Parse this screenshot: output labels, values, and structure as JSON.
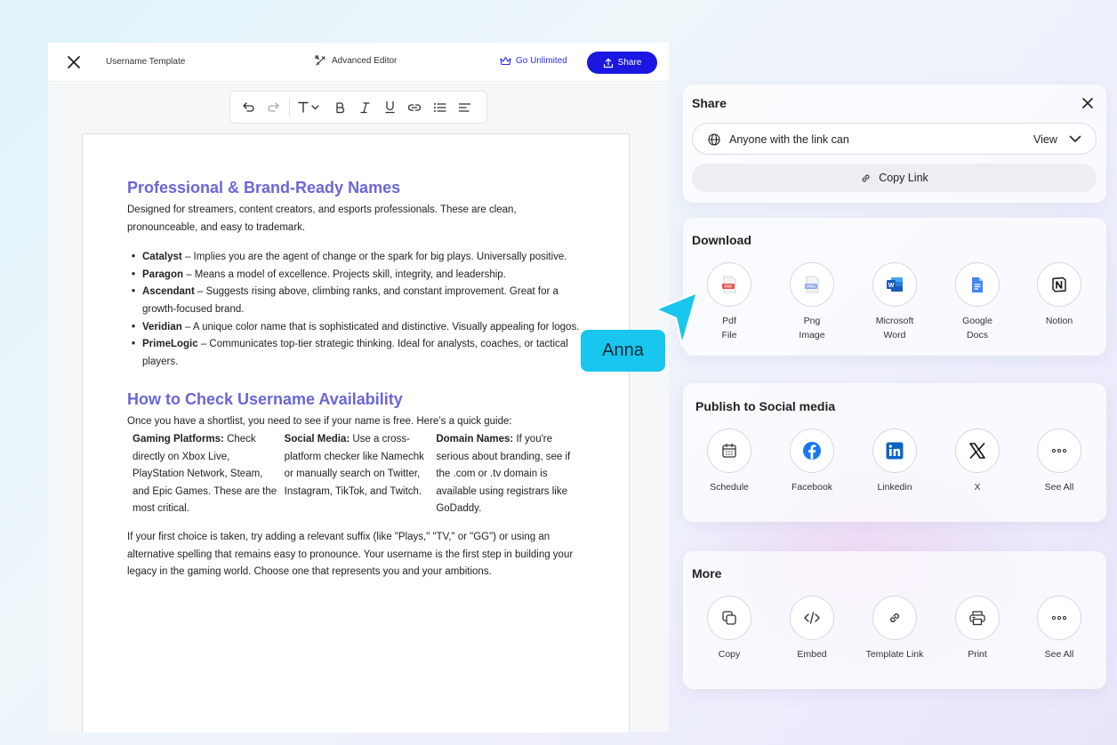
{
  "editor": {
    "doc_title": "Username Template",
    "advanced_editor": "Advanced Editor",
    "go_unlimited": "Go Unlimited",
    "share": "Share",
    "toolbar_icons": [
      "undo-icon",
      "redo-icon",
      "text-style-icon",
      "bold-icon",
      "italic-icon",
      "underline-icon",
      "link-icon",
      "bullet-list-icon",
      "align-left-icon"
    ]
  },
  "document": {
    "section1": {
      "heading": "Professional & Brand-Ready Names",
      "intro": "Designed for streamers, content creators, and esports professionals. These are clean, pronounceable, and easy to trademark.",
      "items": [
        {
          "name": "Catalyst",
          "desc": " – Implies you are the agent of change or the spark for big plays. Universally positive."
        },
        {
          "name": "Paragon",
          "desc": " – Means a model of excellence. Projects skill, integrity, and leadership."
        },
        {
          "name": "Ascendant",
          "desc": " – Suggests rising above, climbing ranks, and constant improvement. Great for a growth-focused brand."
        },
        {
          "name": "Veridian",
          "desc": " – A unique color name that is sophisticated and distinctive. Visually appealing for logos."
        },
        {
          "name": "PrimeLogic",
          "desc": " – Communicates top-tier strategic thinking. Ideal for analysts, coaches, or tactical players."
        }
      ]
    },
    "section2": {
      "heading": "How to Check Username Availability",
      "intro": "Once you have a shortlist, you need to see if your name is free. Here’s a quick guide:",
      "columns": [
        {
          "title": "Gaming Platforms:",
          "text": " Check directly on Xbox Live, PlayStation Network, Steam, and Epic Games. These are the most critical."
        },
        {
          "title": "Social Media:",
          "text": " Use a cross-platform checker like Namechk or manually search on Twitter, Instagram, TikTok, and Twitch."
        },
        {
          "title": "Domain Names:",
          "text": " If you're serious about branding, see if the .com or .tv domain is available using registrars like GoDaddy."
        }
      ],
      "closing": "If your first choice is taken, try adding a relevant suffix (like \"Plays,\" \"TV,\" or \"GG\") or using an alternative spelling that remains easy to pronounce. Your username is the first step in building your legacy in the gaming world. Choose one that represents you and your ambitions."
    }
  },
  "share_panel": {
    "title": "Share",
    "access_text": "Anyone with the link can",
    "access_level": "View",
    "copy_link": "Copy Link"
  },
  "download": {
    "title": "Download",
    "items": [
      {
        "line1": "Pdf",
        "line2": "File",
        "icon": "pdf-file-icon"
      },
      {
        "line1": "Png",
        "line2": "Image",
        "icon": "png-image-icon"
      },
      {
        "line1": "Microsoft",
        "line2": "Word",
        "icon": "microsoft-word-icon"
      },
      {
        "line1": "Google",
        "line2": "Docs",
        "icon": "google-docs-icon"
      },
      {
        "line1": "Notion",
        "line2": "",
        "icon": "notion-icon"
      }
    ]
  },
  "social": {
    "title": "Publish to Social media",
    "items": [
      {
        "label": "Schedule",
        "icon": "calendar-icon"
      },
      {
        "label": "Facebook",
        "icon": "facebook-icon"
      },
      {
        "label": "Linkedin",
        "icon": "linkedin-icon"
      },
      {
        "label": "X",
        "icon": "x-icon"
      },
      {
        "label": "See All",
        "icon": "more-icon"
      }
    ]
  },
  "more": {
    "title": "More",
    "items": [
      {
        "label": "Copy",
        "icon": "copy-icon"
      },
      {
        "label": "Embed",
        "icon": "code-icon"
      },
      {
        "label": "Template Link",
        "icon": "link-icon"
      },
      {
        "label": "Print",
        "icon": "printer-icon"
      },
      {
        "label": "See All",
        "icon": "more-icon"
      }
    ]
  },
  "collaborator": {
    "name": "Anna",
    "color": "#18c6ee"
  },
  "colors": {
    "accent": "#1b17e0",
    "heading": "#6b66d6",
    "cursor": "#18c6ee"
  }
}
